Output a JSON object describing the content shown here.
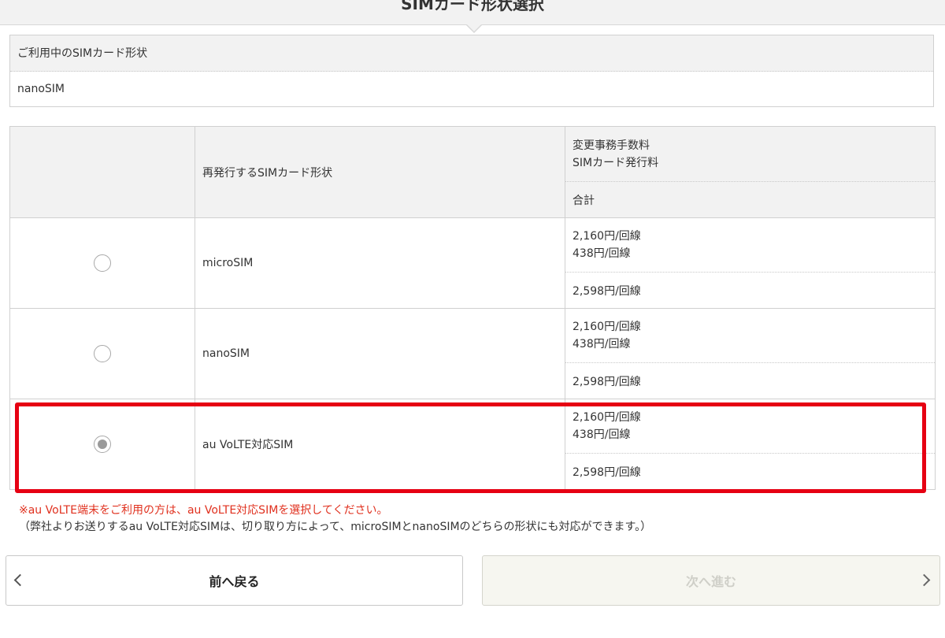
{
  "header": {
    "title": "SIMカード形状選択"
  },
  "current": {
    "label": "ご利用中のSIMカード形状",
    "value": "nanoSIM"
  },
  "table": {
    "head": {
      "type_label": "再発行するSIMカード形状",
      "fee_line1": "変更事務手数料",
      "fee_line2": "SIMカード発行料",
      "total_label": "合計"
    },
    "rows": [
      {
        "type": "microSIM",
        "fee1": "2,160円/回線",
        "fee2": "438円/回線",
        "total": "2,598円/回線",
        "selected": false
      },
      {
        "type": "nanoSIM",
        "fee1": "2,160円/回線",
        "fee2": "438円/回線",
        "total": "2,598円/回線",
        "selected": false
      },
      {
        "type": "au VoLTE対応SIM",
        "fee1": "2,160円/回線",
        "fee2": "438円/回線",
        "total": "2,598円/回線",
        "selected": true
      }
    ]
  },
  "notes": {
    "warning": "※au VoLTE端末をご利用の方は、au VoLTE対応SIMを選択してください。",
    "info": "（弊社よりお送りするau VoLTE対応SIMは、切り取り方によって、microSIMとnanoSIMのどちらの形状にも対応ができます。）"
  },
  "buttons": {
    "back_label": "前へ戻る",
    "next_label": "次へ進む"
  },
  "colors": {
    "highlight": "#e60012",
    "warning_text": "#e0301e"
  }
}
